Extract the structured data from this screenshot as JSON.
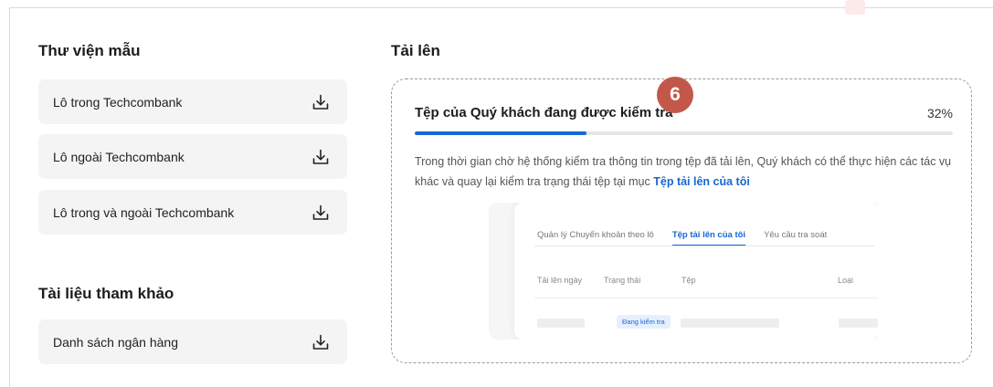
{
  "templates": {
    "title": "Thư viện mẫu",
    "items": [
      {
        "label": "Lô trong Techcombank",
        "icon": "download-icon"
      },
      {
        "label": "Lô ngoài Techcombank",
        "icon": "download-icon"
      },
      {
        "label": "Lô trong và ngoài Techcombank",
        "icon": "download-icon"
      }
    ]
  },
  "references": {
    "title": "Tài liệu tham khảo",
    "items": [
      {
        "label": "Danh sách ngân hàng",
        "icon": "download-icon"
      }
    ]
  },
  "upload": {
    "title": "Tải lên",
    "status_title": "Tệp của Quý khách đang được kiểm tra",
    "percent_label": "32%",
    "progress": 0.32,
    "description": "Trong thời gian chờ hệ thống kiểm tra thông tin trong tệp đã tải lên, Quý khách có thể thực hiện các tác vụ khác và quay lại kiểm tra trạng thái tệp tại mục ",
    "link_text": "Tệp tải lên của tôi",
    "step_badge": "6",
    "preview": {
      "tabs": [
        "Quản lý Chuyển khoản theo lô",
        "Tệp tải lên của tôi",
        "Yêu cầu tra soát"
      ],
      "active_tab": 1,
      "columns": [
        "Tải lên ngày",
        "Trạng thái",
        "Tệp",
        "Loại"
      ],
      "row_status": "Đang kiểm tra"
    }
  },
  "colors": {
    "accent": "#1766d6",
    "badge": "#c2584a",
    "item_bg": "#f4f4f5"
  }
}
